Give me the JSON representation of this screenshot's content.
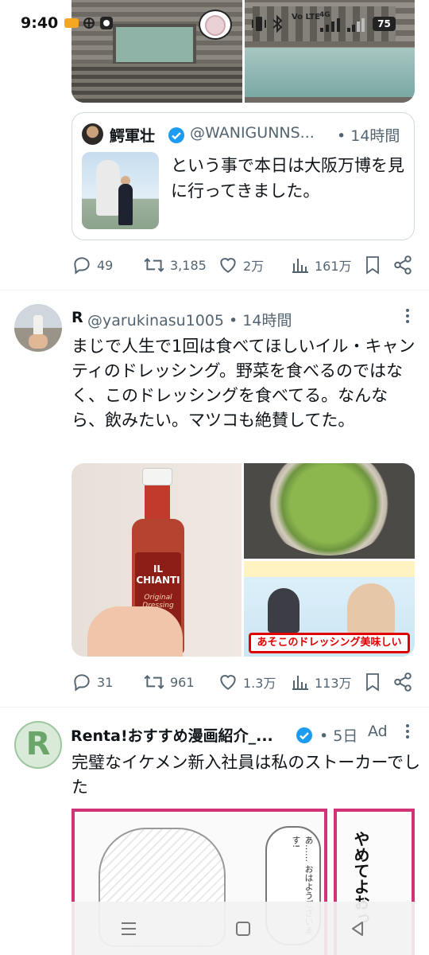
{
  "status_bar": {
    "time": "9:40",
    "network": "Vo LTE",
    "signal": "4G",
    "battery": "75"
  },
  "tweet1": {
    "quote": {
      "name": "鰐軍壮",
      "handle": "@WANIGUNNS...",
      "time": "• 14時間",
      "text": "という事で本日は大阪万博を見に行ってきました。"
    },
    "actions": {
      "replies": "49",
      "retweets": "3,185",
      "likes": "2万",
      "views": "161万"
    }
  },
  "tweet2": {
    "name": "R",
    "handle_time": "@yarukinasu1005 • 14時間",
    "text": "まじで人生で1回は食べてほしいイル・キャンティのドレッシング。野菜を食べるのではなく、このドレッシングを食べてる。なんなら、飲みたい。マツコも絶賛してた。",
    "media": {
      "bottle_label": "IL CHIANTI",
      "bottle_sub": "Original Dressing",
      "caption": "あそこのドレッシング美味しい"
    },
    "actions": {
      "replies": "31",
      "retweets": "961",
      "likes": "1.3万",
      "views": "113万"
    }
  },
  "tweet3": {
    "avatar_letter": "R",
    "name": "Renta!おすすめ漫画紹介_...",
    "time": "• 5日",
    "ad_label": "Ad",
    "text": "完璧なイケメン新入社員は私のストーカーでした",
    "manga": {
      "bubble": "あ…… おはようございます!",
      "side_text": "やめてよおっ"
    }
  },
  "colors": {
    "accent_blue": "#1d9bf0",
    "muted_text": "#536471",
    "border": "#cfd9de"
  }
}
